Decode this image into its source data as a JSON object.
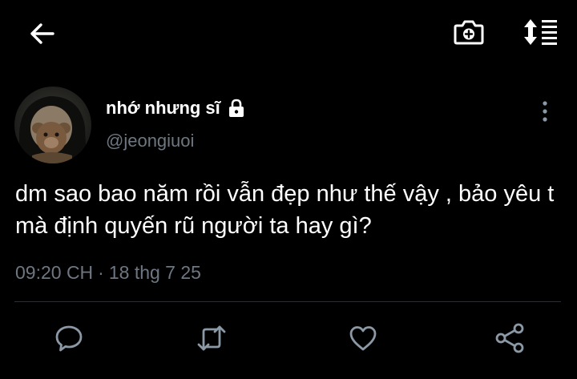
{
  "header": {
    "back_icon": "arrow-left-icon",
    "camera_icon": "camera-plus-icon",
    "sort_icon": "sort-list-icon"
  },
  "tweet": {
    "display_name": "nhớ nhưng sĩ",
    "protected_icon": "lock-icon",
    "handle": "@jeongiuoi",
    "text": "dm sao bao năm rồi vẫn đẹp như thế vậy , bảo yêu t mà định quyến rũ người ta hay gì?",
    "time": "09:20 CH",
    "separator": "·",
    "date": "18 thg 7 25",
    "more_icon": "more-vertical-icon"
  },
  "actions": [
    {
      "icon": "reply-icon"
    },
    {
      "icon": "retweet-icon"
    },
    {
      "icon": "like-icon"
    },
    {
      "icon": "share-icon"
    }
  ],
  "colors": {
    "background": "#000000",
    "text": "#ffffff",
    "secondary_text": "#6e7781",
    "icon": "#8b98a5",
    "divider": "#2a2f33"
  }
}
